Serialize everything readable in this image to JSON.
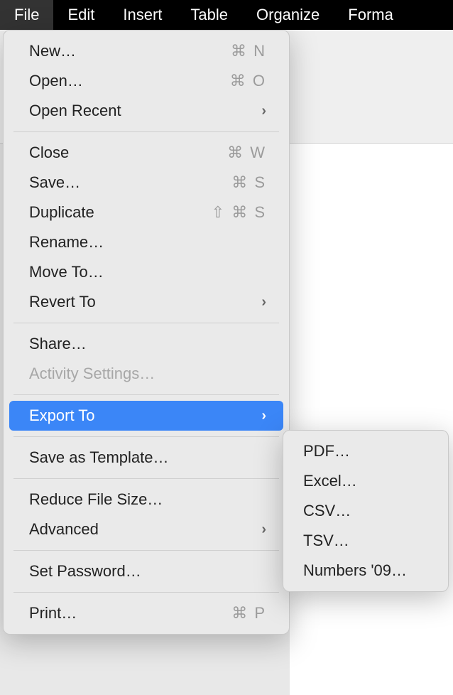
{
  "menubar": {
    "items": [
      {
        "label": "File",
        "active": true
      },
      {
        "label": "Edit",
        "active": false
      },
      {
        "label": "Insert",
        "active": false
      },
      {
        "label": "Table",
        "active": false
      },
      {
        "label": "Organize",
        "active": false
      },
      {
        "label": "Forma",
        "active": false
      }
    ]
  },
  "file_menu": {
    "items": [
      {
        "label": "New…",
        "shortcut": "⌘ N",
        "submenu": false,
        "disabled": false
      },
      {
        "label": "Open…",
        "shortcut": "⌘ O",
        "submenu": false,
        "disabled": false
      },
      {
        "label": "Open Recent",
        "shortcut": "",
        "submenu": true,
        "disabled": false
      },
      {
        "separator": true
      },
      {
        "label": "Close",
        "shortcut": "⌘ W",
        "submenu": false,
        "disabled": false
      },
      {
        "label": "Save…",
        "shortcut": "⌘ S",
        "submenu": false,
        "disabled": false
      },
      {
        "label": "Duplicate",
        "shortcut": "⇧ ⌘ S",
        "submenu": false,
        "disabled": false
      },
      {
        "label": "Rename…",
        "shortcut": "",
        "submenu": false,
        "disabled": false
      },
      {
        "label": "Move To…",
        "shortcut": "",
        "submenu": false,
        "disabled": false
      },
      {
        "label": "Revert To",
        "shortcut": "",
        "submenu": true,
        "disabled": false
      },
      {
        "separator": true
      },
      {
        "label": "Share…",
        "shortcut": "",
        "submenu": false,
        "disabled": false
      },
      {
        "label": "Activity Settings…",
        "shortcut": "",
        "submenu": false,
        "disabled": true
      },
      {
        "separator": true
      },
      {
        "label": "Export To",
        "shortcut": "",
        "submenu": true,
        "disabled": false,
        "highlighted": true
      },
      {
        "separator": true
      },
      {
        "label": "Save as Template…",
        "shortcut": "",
        "submenu": false,
        "disabled": false
      },
      {
        "separator": true
      },
      {
        "label": "Reduce File Size…",
        "shortcut": "",
        "submenu": false,
        "disabled": false
      },
      {
        "label": "Advanced",
        "shortcut": "",
        "submenu": true,
        "disabled": false
      },
      {
        "separator": true
      },
      {
        "label": "Set Password…",
        "shortcut": "",
        "submenu": false,
        "disabled": false
      },
      {
        "separator": true
      },
      {
        "label": "Print…",
        "shortcut": "⌘ P",
        "submenu": false,
        "disabled": false
      }
    ]
  },
  "export_submenu": {
    "items": [
      {
        "label": "PDF…"
      },
      {
        "label": "Excel…"
      },
      {
        "label": "CSV…"
      },
      {
        "label": "TSV…"
      },
      {
        "label": "Numbers '09…"
      }
    ]
  }
}
